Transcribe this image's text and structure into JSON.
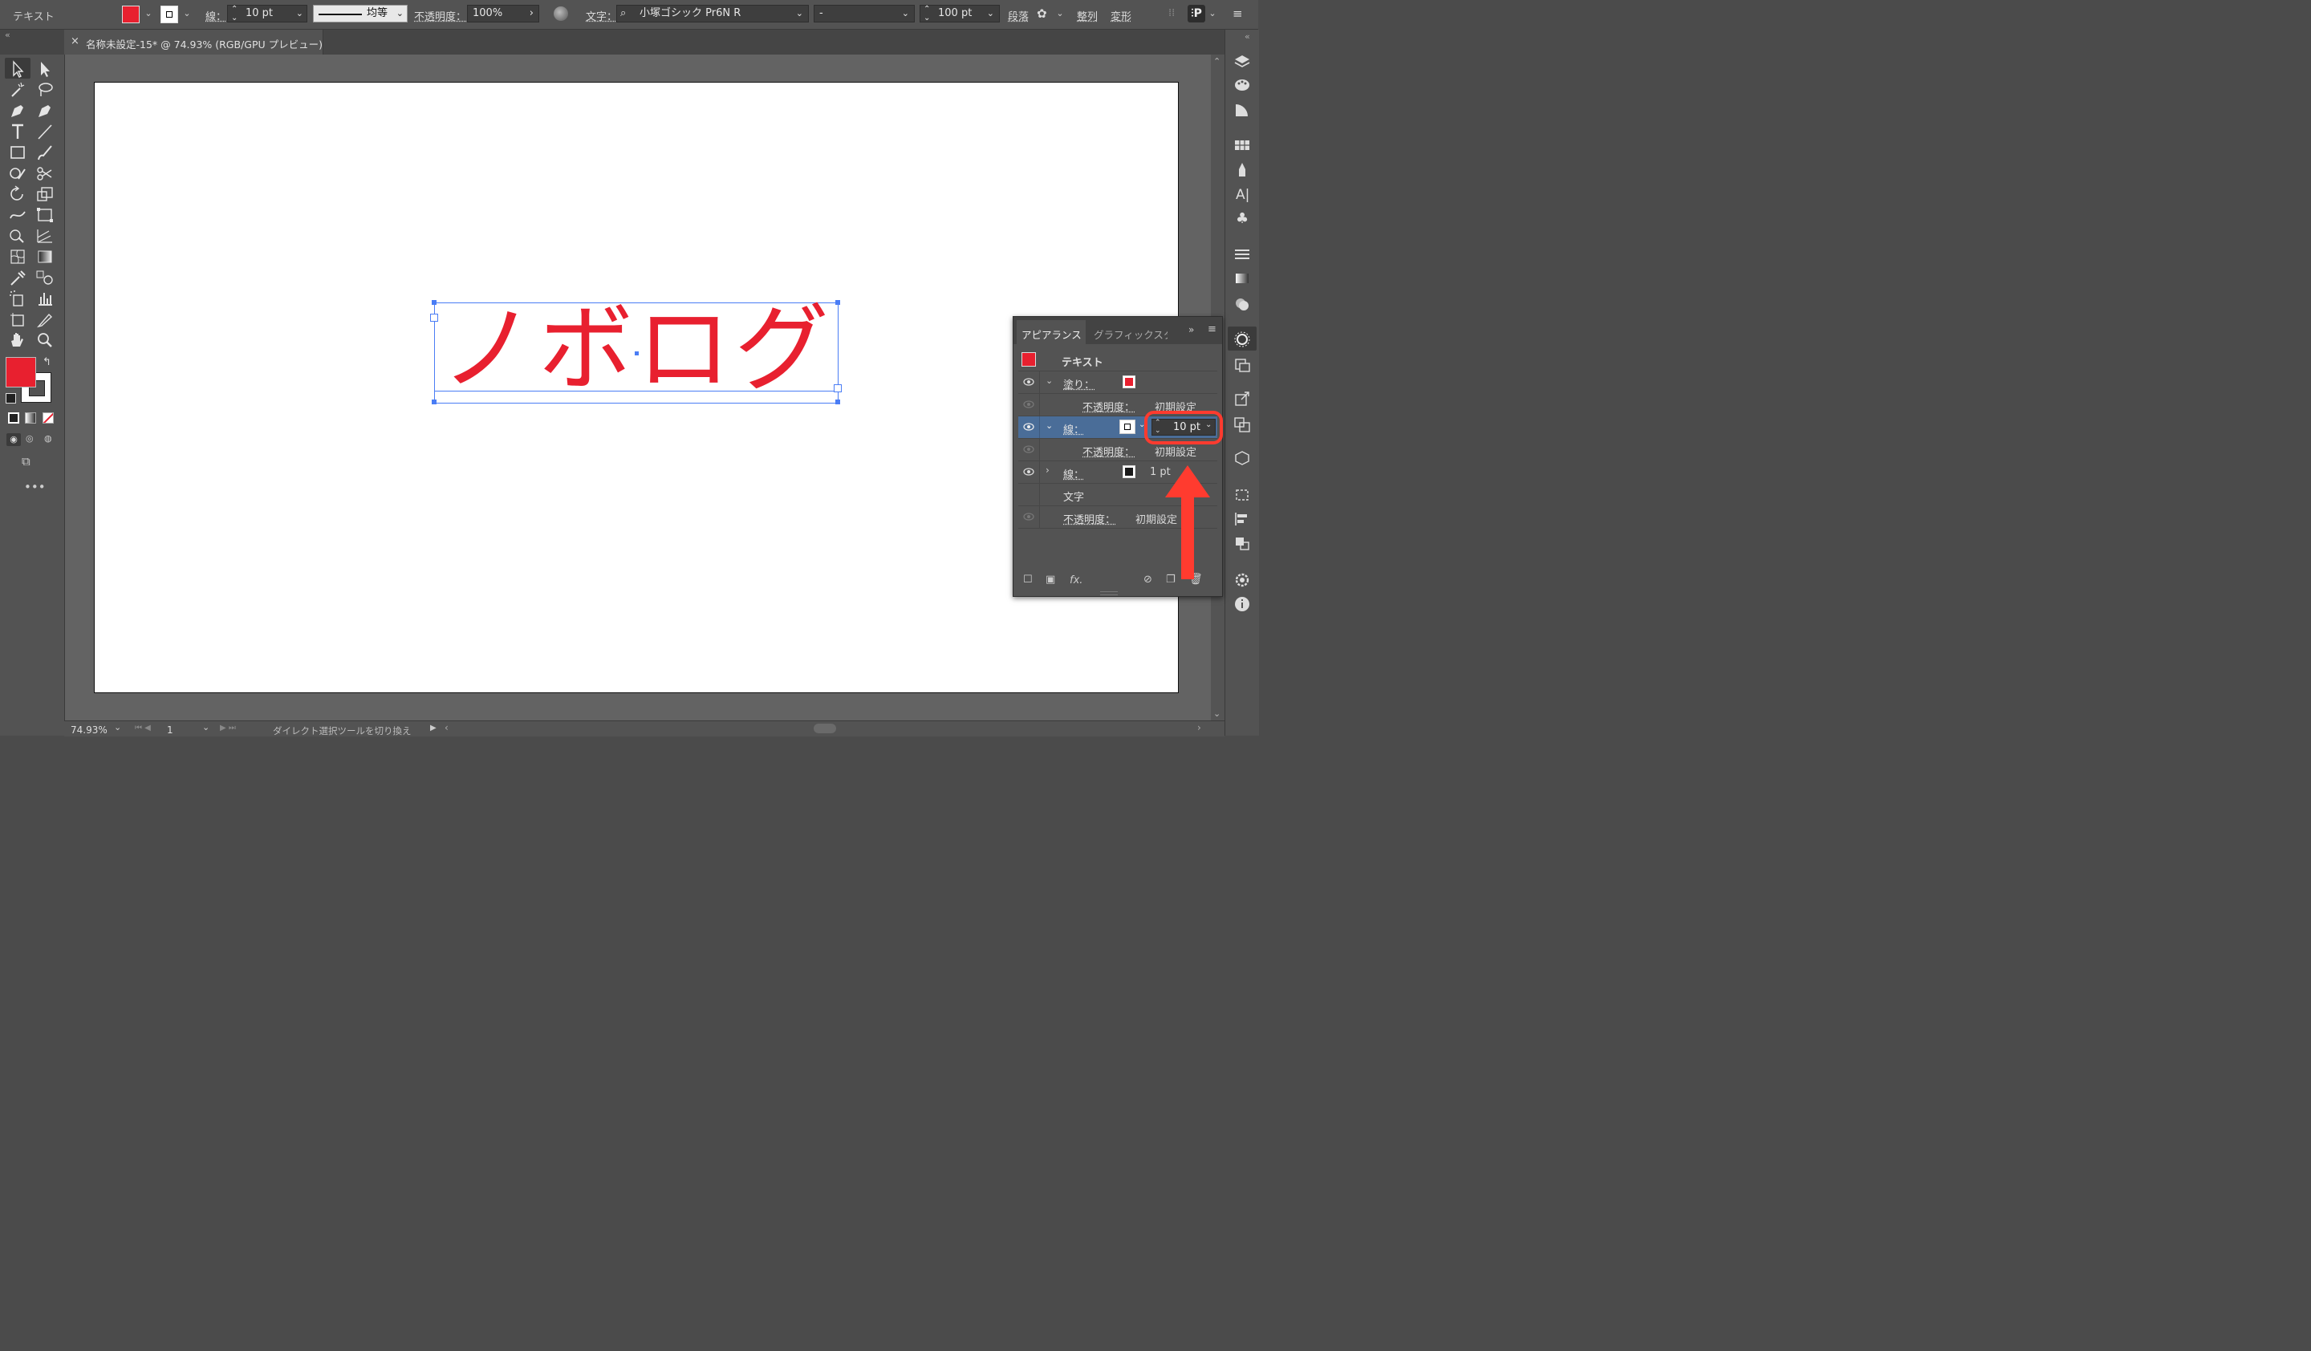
{
  "control_bar": {
    "object_type": "テキスト",
    "stroke_label": "線：",
    "stroke_weight": "10 pt",
    "stroke_profile": "均等",
    "opacity_label": "不透明度：",
    "opacity_value": "100%",
    "char_label": "文字：",
    "font_family": "小塚ゴシック Pr6N R",
    "font_style": "-",
    "font_size": "100 pt",
    "paragraph_label": "段落",
    "align_label": "整列",
    "transform_label": "変形"
  },
  "document_tab": {
    "close": "×",
    "title": "名称未設定-15* @ 74.93% (RGB/GPU プレビュー)"
  },
  "canvas": {
    "text": "ノボログ"
  },
  "appearance_panel": {
    "tab_active": "アピアランス",
    "tab_inactive": "グラフィックスタ",
    "header_label": "テキスト",
    "rows": [
      {
        "label": "塗り：",
        "value": ""
      },
      {
        "label": "不透明度：",
        "value": "初期設定"
      },
      {
        "label": "線：",
        "value": "10 pt"
      },
      {
        "label": "不透明度：",
        "value": "初期設定"
      },
      {
        "label": "線：",
        "value": "1 pt"
      },
      {
        "label": "文字",
        "value": ""
      },
      {
        "label": "不透明度：",
        "value": "初期設定"
      }
    ],
    "fx_label": "fx."
  },
  "status_bar": {
    "zoom": "74.93%",
    "artboard_number": "1",
    "status_text": "ダイレクト選択ツールを切り換え"
  },
  "colors": {
    "fill": "#e8202f",
    "highlight": "#ff3b2f",
    "selection": "#4a7df5"
  }
}
